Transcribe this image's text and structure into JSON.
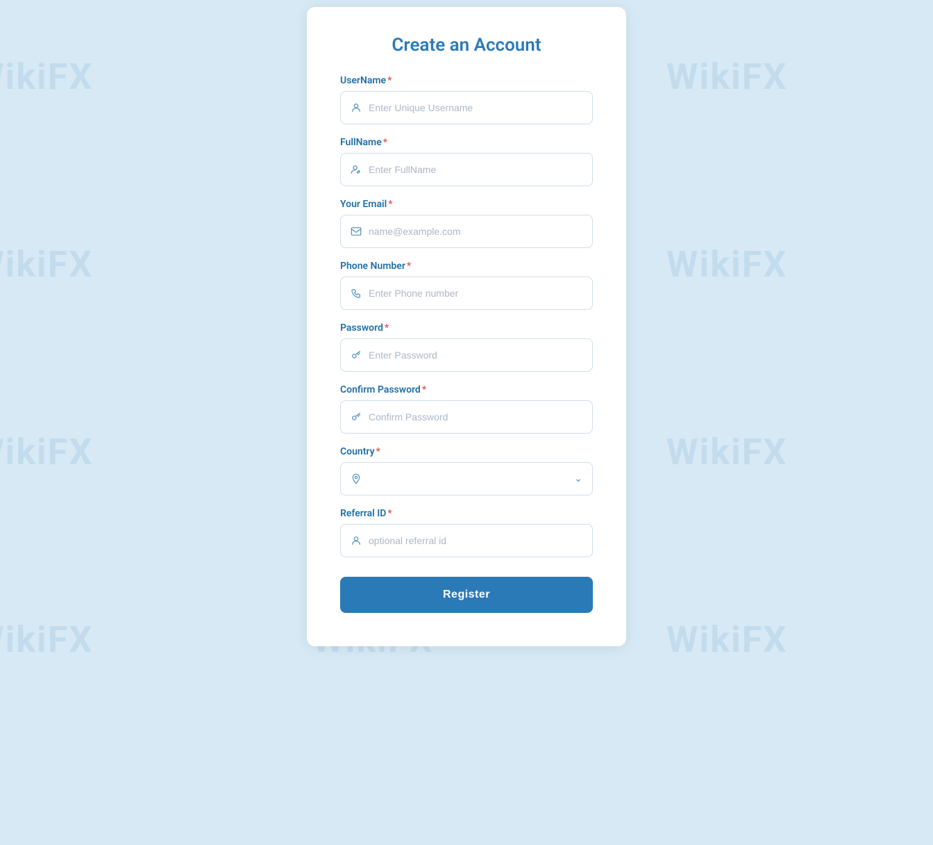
{
  "page": {
    "title": "Create an Account",
    "background_color": "#d6e9f5"
  },
  "watermark_text": "WikiFX",
  "form": {
    "fields": [
      {
        "id": "username",
        "label": "UserName",
        "required": true,
        "type": "text",
        "placeholder": "Enter Unique Username",
        "icon": "user-icon"
      },
      {
        "id": "fullname",
        "label": "FullName",
        "required": true,
        "type": "text",
        "placeholder": "Enter FullName",
        "icon": "user-edit-icon"
      },
      {
        "id": "email",
        "label": "Your Email",
        "required": true,
        "type": "email",
        "placeholder": "name@example.com",
        "icon": "mail-icon"
      },
      {
        "id": "phone",
        "label": "Phone Number",
        "required": true,
        "type": "tel",
        "placeholder": "Enter Phone number",
        "icon": "phone-icon"
      },
      {
        "id": "password",
        "label": "Password",
        "required": true,
        "type": "password",
        "placeholder": "Enter Password",
        "icon": "key-icon"
      },
      {
        "id": "confirm_password",
        "label": "Confirm Password",
        "required": true,
        "type": "password",
        "placeholder": "Confirm Password",
        "icon": "key-icon-2"
      }
    ],
    "country_field": {
      "label": "Country",
      "required": true,
      "placeholder": ""
    },
    "referral_field": {
      "label": "Referral ID",
      "required": true,
      "placeholder": "optional referral id",
      "type": "text"
    },
    "submit_button": "Register",
    "required_marker": "*"
  }
}
